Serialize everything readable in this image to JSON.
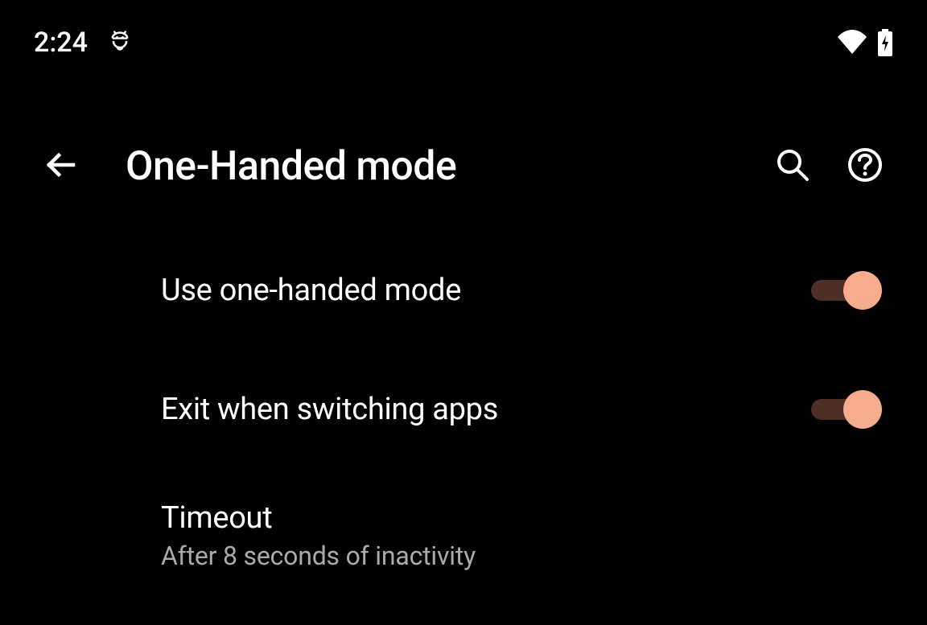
{
  "statusBar": {
    "time": "2:24"
  },
  "header": {
    "title": "One-Handed mode"
  },
  "settings": [
    {
      "title": "Use one-handed mode",
      "enabled": true
    },
    {
      "title": "Exit when switching apps",
      "enabled": true
    },
    {
      "title": "Timeout",
      "subtitle": "After 8 seconds of inactivity"
    }
  ],
  "colors": {
    "toggleThumb": "#f6ad8d",
    "toggleTrack": "#4d2f25",
    "background": "#000000",
    "textPrimary": "#ffffff",
    "textSecondary": "#aaaaaa"
  }
}
